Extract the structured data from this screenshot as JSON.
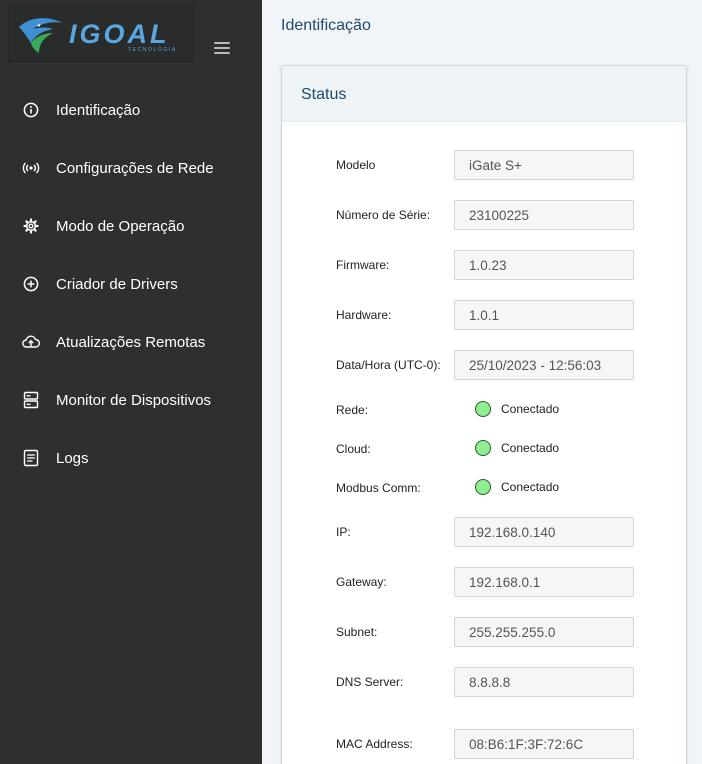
{
  "brand": {
    "name": "IGOAL",
    "tagline": "TECNOLOGIA"
  },
  "sidebar": {
    "items": [
      {
        "label": "Identificação",
        "icon": "info-icon"
      },
      {
        "label": "Configurações de Rede",
        "icon": "broadcast-icon"
      },
      {
        "label": "Modo de Operação",
        "icon": "gear-icon"
      },
      {
        "label": "Criador de Drivers",
        "icon": "plus-circle-icon"
      },
      {
        "label": "Atualizações Remotas",
        "icon": "cloud-upload-icon"
      },
      {
        "label": "Monitor de Dispositivos",
        "icon": "server-icon"
      },
      {
        "label": "Logs",
        "icon": "document-icon"
      }
    ]
  },
  "page": {
    "title": "Identificação"
  },
  "status": {
    "title": "Status",
    "fields": {
      "modelo": {
        "label": "Modelo",
        "value": "iGate S+"
      },
      "serie": {
        "label": "Número de Série:",
        "value": "23100225"
      },
      "firmware": {
        "label": "Firmware:",
        "value": "1.0.23"
      },
      "hardware": {
        "label": "Hardware:",
        "value": "1.0.1"
      },
      "datahora": {
        "label": "Data/Hora (UTC-0):",
        "value": "25/10/2023 - 12:56:03"
      },
      "ip": {
        "label": "IP:",
        "value": "192.168.0.140"
      },
      "gateway": {
        "label": "Gateway:",
        "value": "192.168.0.1"
      },
      "subnet": {
        "label": "Subnet:",
        "value": "255.255.255.0"
      },
      "dns": {
        "label": "DNS Server:",
        "value": "8.8.8.8"
      },
      "mac": {
        "label": "MAC Address:",
        "value": "08:B6:1F:3F:72:6C"
      }
    },
    "indicators": {
      "rede": {
        "label": "Rede:",
        "value": "Conectado",
        "color": "#90ee90"
      },
      "cloud": {
        "label": "Cloud:",
        "value": "Conectado",
        "color": "#90ee90"
      },
      "modbus": {
        "label": "Modbus Comm:",
        "value": "Conectado",
        "color": "#90ee90"
      }
    }
  },
  "colors": {
    "sidebar_bg": "#2e302f",
    "accent": "#1e4a6b",
    "logo_blue": "#5aa6e0",
    "status_green": "#90ee90"
  }
}
